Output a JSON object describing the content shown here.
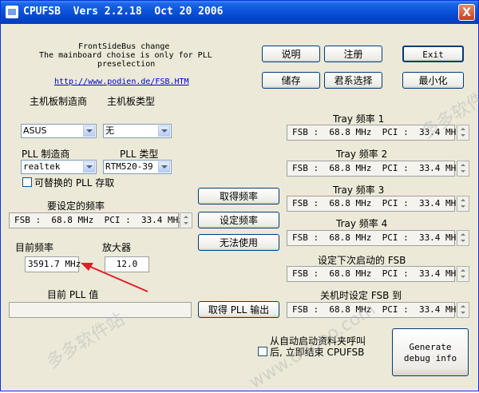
{
  "window": {
    "title": "CPUFSB  Vers 2.2.18  Oct 20 2006",
    "close_label": "X"
  },
  "intro": {
    "line1": "FrontSideBus change",
    "line2": "The mainboard choise is only for PLL",
    "line3": "preselection",
    "link": "http://www.podien.de/FSB.HTM"
  },
  "buttons": {
    "help": "说明",
    "register": "注册",
    "exit": "Exit",
    "save": "储存",
    "language": "君系选择",
    "minimize": "最小化",
    "get_freq": "取得频率",
    "set_freq": "设定频率",
    "unusable": "无法使用",
    "get_pll": "取得 PLL 输出",
    "debug": "Generate debug info"
  },
  "labels": {
    "mb_maker": "主机板制造商",
    "mb_type": "主机板类型",
    "pll_maker": "PLL 制造商",
    "pll_type": "PLL 类型",
    "replaceable_pll": "可替换的 PLL 存取",
    "freq_to_set": "要设定的频率",
    "current_freq": "目前频率",
    "multiplier": "放大器",
    "current_pll": "目前 PLL 值",
    "tray1": "Tray 频率 1",
    "tray2": "Tray 频率 2",
    "tray3": "Tray 频率 3",
    "tray4": "Tray 频率 4",
    "next_boot": "设定下次启动的 FSB",
    "shutdown_fsb": "关机时设定 FSB 到",
    "autostart_line1": "从自动启动资料夹呼叫",
    "autostart_line2": "后, 立即结束 CPUFSB"
  },
  "selects": {
    "mb_maker": "ASUS",
    "mb_type": "无",
    "pll_maker": "realtek",
    "pll_type": "RTM520-39"
  },
  "values": {
    "freq_to_set": "FSB :  68.8 MHz  PCI :  33.4 MHz",
    "current_freq": "3591.7 MHz",
    "multiplier": "12.0",
    "current_pll": "",
    "tray1": "FSB :  68.8 MHz  PCI :  33.4 MHz",
    "tray2": "FSB :  68.8 MHz  PCI :  33.4 MHz",
    "tray3": "FSB :  68.8 MHz  PCI :  33.4 MHz",
    "tray4": "FSB :  68.8 MHz  PCI :  33.4 MHz",
    "next_boot": "FSB :  68.8 MHz  PCI :  33.4 MHz",
    "shutdown_fsb": "FSB :  68.8 MHz  PCI :  33.4 MHz"
  },
  "watermark": {
    "w1": "多多软件站",
    "w2": "www.ddooo.com"
  },
  "colors": {
    "titlebar": "#0A53D8",
    "face": "#ECE9D8",
    "arrow": "#E0202A",
    "link": "#0000CC"
  }
}
